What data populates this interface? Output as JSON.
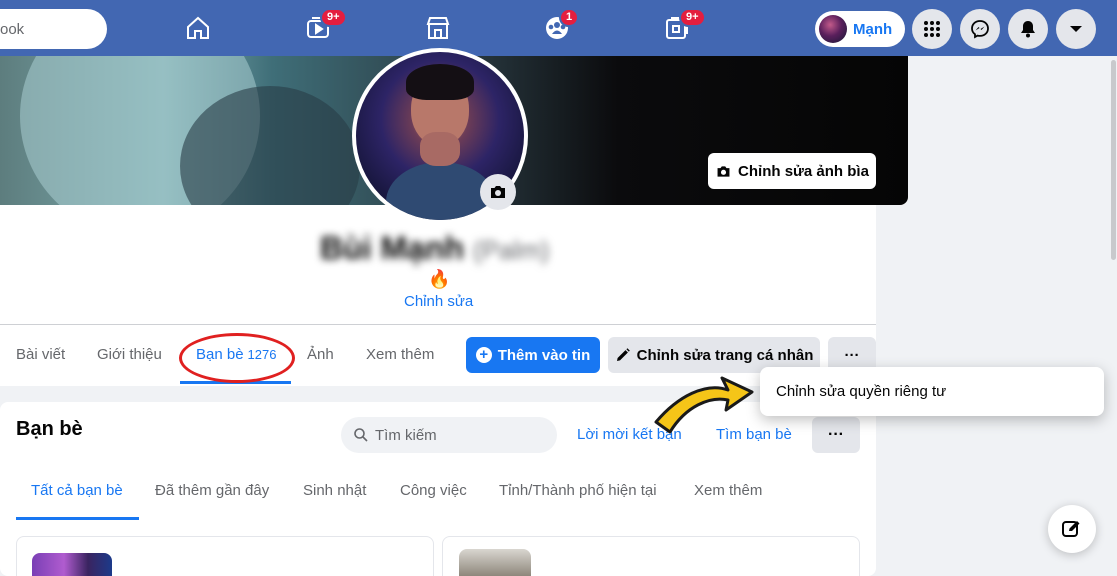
{
  "topbar": {
    "search_text": "ook",
    "badges": {
      "watch": "9+",
      "groups": "1",
      "gaming": "9+"
    },
    "profile_name": "Mạnh",
    "icons": [
      "home-icon",
      "watch-icon",
      "marketplace-icon",
      "groups-icon",
      "gaming-icon",
      "menu-grid-icon",
      "messenger-icon",
      "notifications-icon",
      "account-dropdown-icon"
    ]
  },
  "profile": {
    "edit_cover_label": "Chỉnh sửa ảnh bìa",
    "name": "Bùi Mạnh",
    "alt_name": "(Palm)",
    "bio_emoji": "🔥",
    "edit_bio_label": "Chỉnh sửa"
  },
  "tabs": [
    {
      "label": "Bài viết"
    },
    {
      "label": "Giới thiệu"
    },
    {
      "label": "Bạn bè",
      "count": "1276"
    },
    {
      "label": "Ảnh"
    },
    {
      "label": "Xem thêm"
    }
  ],
  "actions": {
    "add_story": "Thêm vào tin",
    "edit_profile": "Chỉnh sửa trang cá nhân",
    "more": "···"
  },
  "dropdown": {
    "privacy_label": "Chỉnh sửa quyền riêng tư"
  },
  "friends": {
    "title": "Bạn bè",
    "search_placeholder": "Tìm kiếm",
    "requests_link": "Lời mời kết bạn",
    "find_link": "Tìm bạn bè",
    "more": "···",
    "subtabs": [
      "Tất cả bạn bè",
      "Đã thêm gần đây",
      "Sinh nhật",
      "Công việc",
      "Tỉnh/Thành phố hiện tại",
      "Xem thêm"
    ]
  },
  "colors": {
    "topbar": "#4267b2",
    "accent": "#1877f2",
    "badge": "#e41e3f",
    "annotation_circle": "#e02020",
    "annotation_arrow": "#f5c518"
  }
}
